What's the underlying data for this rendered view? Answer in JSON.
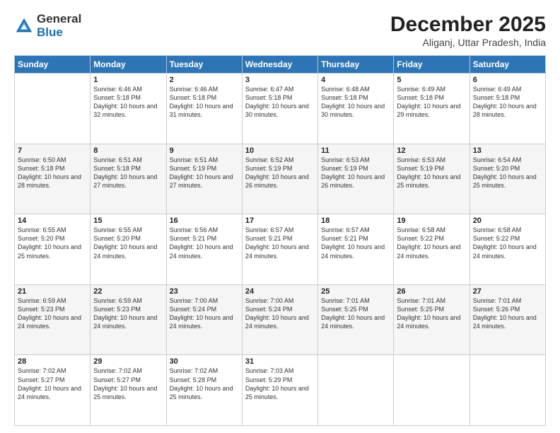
{
  "header": {
    "logo_general": "General",
    "logo_blue": "Blue",
    "month_year": "December 2025",
    "location": "Aliganj, Uttar Pradesh, India"
  },
  "weekdays": [
    "Sunday",
    "Monday",
    "Tuesday",
    "Wednesday",
    "Thursday",
    "Friday",
    "Saturday"
  ],
  "weeks": [
    [
      {
        "day": "",
        "info": ""
      },
      {
        "day": "1",
        "info": "Sunrise: 6:46 AM\nSunset: 5:18 PM\nDaylight: 10 hours\nand 32 minutes."
      },
      {
        "day": "2",
        "info": "Sunrise: 6:46 AM\nSunset: 5:18 PM\nDaylight: 10 hours\nand 31 minutes."
      },
      {
        "day": "3",
        "info": "Sunrise: 6:47 AM\nSunset: 5:18 PM\nDaylight: 10 hours\nand 30 minutes."
      },
      {
        "day": "4",
        "info": "Sunrise: 6:48 AM\nSunset: 5:18 PM\nDaylight: 10 hours\nand 30 minutes."
      },
      {
        "day": "5",
        "info": "Sunrise: 6:49 AM\nSunset: 5:18 PM\nDaylight: 10 hours\nand 29 minutes."
      },
      {
        "day": "6",
        "info": "Sunrise: 6:49 AM\nSunset: 5:18 PM\nDaylight: 10 hours\nand 28 minutes."
      }
    ],
    [
      {
        "day": "7",
        "info": "Sunrise: 6:50 AM\nSunset: 5:18 PM\nDaylight: 10 hours\nand 28 minutes."
      },
      {
        "day": "8",
        "info": "Sunrise: 6:51 AM\nSunset: 5:18 PM\nDaylight: 10 hours\nand 27 minutes."
      },
      {
        "day": "9",
        "info": "Sunrise: 6:51 AM\nSunset: 5:19 PM\nDaylight: 10 hours\nand 27 minutes."
      },
      {
        "day": "10",
        "info": "Sunrise: 6:52 AM\nSunset: 5:19 PM\nDaylight: 10 hours\nand 26 minutes."
      },
      {
        "day": "11",
        "info": "Sunrise: 6:53 AM\nSunset: 5:19 PM\nDaylight: 10 hours\nand 26 minutes."
      },
      {
        "day": "12",
        "info": "Sunrise: 6:53 AM\nSunset: 5:19 PM\nDaylight: 10 hours\nand 25 minutes."
      },
      {
        "day": "13",
        "info": "Sunrise: 6:54 AM\nSunset: 5:20 PM\nDaylight: 10 hours\nand 25 minutes."
      }
    ],
    [
      {
        "day": "14",
        "info": "Sunrise: 6:55 AM\nSunset: 5:20 PM\nDaylight: 10 hours\nand 25 minutes."
      },
      {
        "day": "15",
        "info": "Sunrise: 6:55 AM\nSunset: 5:20 PM\nDaylight: 10 hours\nand 24 minutes."
      },
      {
        "day": "16",
        "info": "Sunrise: 6:56 AM\nSunset: 5:21 PM\nDaylight: 10 hours\nand 24 minutes."
      },
      {
        "day": "17",
        "info": "Sunrise: 6:57 AM\nSunset: 5:21 PM\nDaylight: 10 hours\nand 24 minutes."
      },
      {
        "day": "18",
        "info": "Sunrise: 6:57 AM\nSunset: 5:21 PM\nDaylight: 10 hours\nand 24 minutes."
      },
      {
        "day": "19",
        "info": "Sunrise: 6:58 AM\nSunset: 5:22 PM\nDaylight: 10 hours\nand 24 minutes."
      },
      {
        "day": "20",
        "info": "Sunrise: 6:58 AM\nSunset: 5:22 PM\nDaylight: 10 hours\nand 24 minutes."
      }
    ],
    [
      {
        "day": "21",
        "info": "Sunrise: 6:59 AM\nSunset: 5:23 PM\nDaylight: 10 hours\nand 24 minutes."
      },
      {
        "day": "22",
        "info": "Sunrise: 6:59 AM\nSunset: 5:23 PM\nDaylight: 10 hours\nand 24 minutes."
      },
      {
        "day": "23",
        "info": "Sunrise: 7:00 AM\nSunset: 5:24 PM\nDaylight: 10 hours\nand 24 minutes."
      },
      {
        "day": "24",
        "info": "Sunrise: 7:00 AM\nSunset: 5:24 PM\nDaylight: 10 hours\nand 24 minutes."
      },
      {
        "day": "25",
        "info": "Sunrise: 7:01 AM\nSunset: 5:25 PM\nDaylight: 10 hours\nand 24 minutes."
      },
      {
        "day": "26",
        "info": "Sunrise: 7:01 AM\nSunset: 5:25 PM\nDaylight: 10 hours\nand 24 minutes."
      },
      {
        "day": "27",
        "info": "Sunrise: 7:01 AM\nSunset: 5:26 PM\nDaylight: 10 hours\nand 24 minutes."
      }
    ],
    [
      {
        "day": "28",
        "info": "Sunrise: 7:02 AM\nSunset: 5:27 PM\nDaylight: 10 hours\nand 24 minutes."
      },
      {
        "day": "29",
        "info": "Sunrise: 7:02 AM\nSunset: 5:27 PM\nDaylight: 10 hours\nand 25 minutes."
      },
      {
        "day": "30",
        "info": "Sunrise: 7:02 AM\nSunset: 5:28 PM\nDaylight: 10 hours\nand 25 minutes."
      },
      {
        "day": "31",
        "info": "Sunrise: 7:03 AM\nSunset: 5:29 PM\nDaylight: 10 hours\nand 25 minutes."
      },
      {
        "day": "",
        "info": ""
      },
      {
        "day": "",
        "info": ""
      },
      {
        "day": "",
        "info": ""
      }
    ]
  ]
}
